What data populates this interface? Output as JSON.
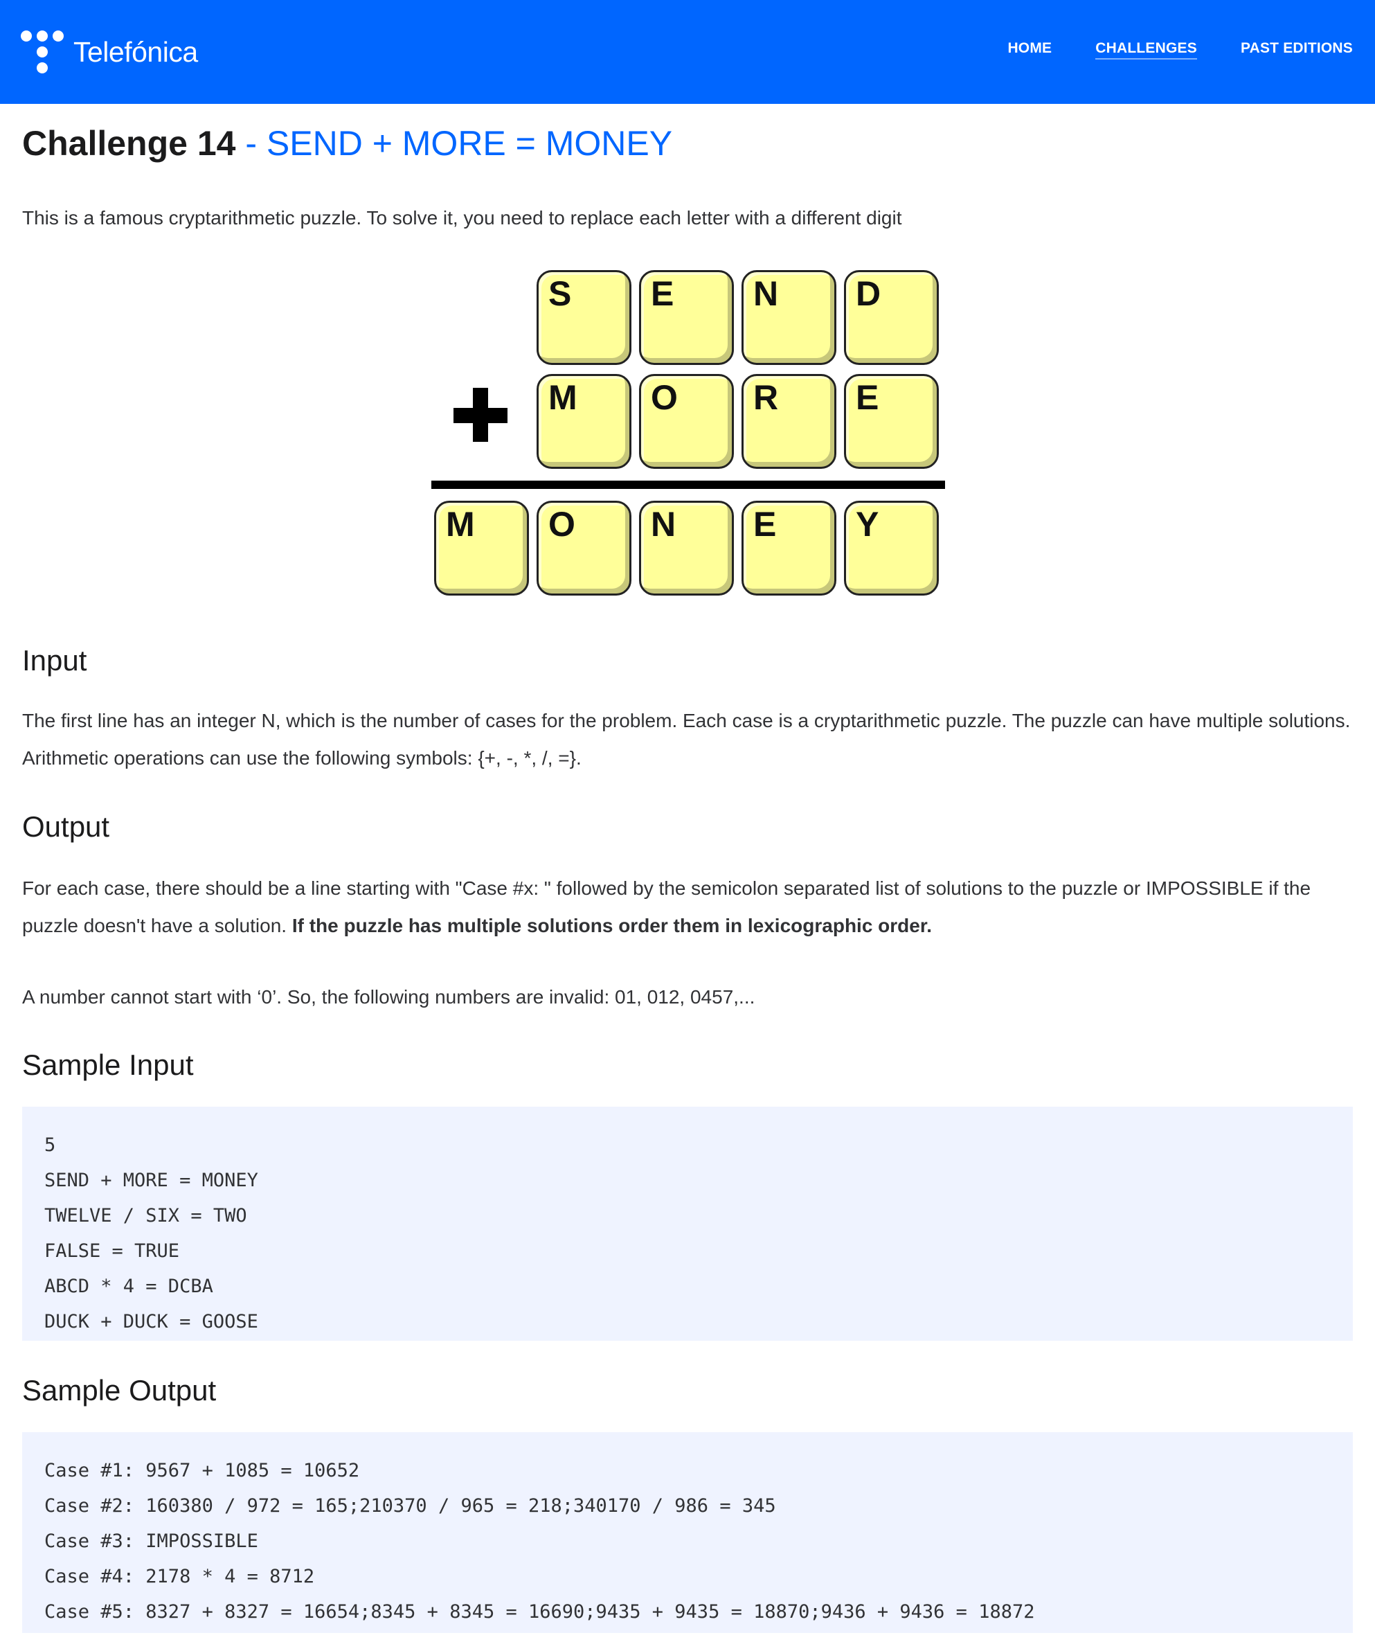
{
  "header": {
    "brand": "Telefónica",
    "nav": [
      {
        "label": "HOME"
      },
      {
        "label": "CHALLENGES"
      },
      {
        "label": "PAST EDITIONS"
      }
    ],
    "colors": {
      "bar": "#0066ff",
      "text": "#ffffff"
    }
  },
  "title": {
    "main": "Challenge 14",
    "sub": " - SEND + MORE = MONEY"
  },
  "intro": "This is a famous cryptarithmetic puzzle. To solve it, you need to replace each letter with a different digit",
  "puzzle": {
    "row1": [
      "S",
      "E",
      "N",
      "D"
    ],
    "operator": "+",
    "row2": [
      "M",
      "O",
      "R",
      "E"
    ],
    "row3": [
      "M",
      "O",
      "N",
      "E",
      "Y"
    ]
  },
  "input": {
    "heading": "Input",
    "text": "The first line has an integer N, which is the number of cases for the problem. Each case is a cryptarithmetic puzzle. The puzzle can have multiple solutions. Arithmetic operations can use the following symbols: {+, -, *, /, =}."
  },
  "output": {
    "heading": "Output",
    "text": "For each case, there should be a line starting with \"Case #x: \" followed by the semicolon separated list of solutions to the puzzle or IMPOSSIBLE if the puzzle doesn't have a solution. ",
    "bold": "If the puzzle has multiple solutions order them in lexicographic order.",
    "note": "A number cannot start with ‘0’. So, the following numbers are invalid: 01, 012, 0457,..."
  },
  "sample_input": {
    "heading": "Sample Input",
    "lines": [
      "5",
      "SEND + MORE = MONEY",
      "TWELVE / SIX = TWO",
      "FALSE = TRUE",
      "ABCD * 4 = DCBA",
      "DUCK + DUCK = GOOSE"
    ]
  },
  "sample_output": {
    "heading": "Sample Output",
    "lines": [
      "Case #1: 9567 + 1085 = 10652",
      "Case #2: 160380 / 972 = 165;210370 / 965 = 218;340170 / 986 = 345",
      "Case #3: IMPOSSIBLE",
      "Case #4: 2178 * 4 = 8712",
      "Case #5: 8327 + 8327 = 16654;8345 + 8345 = 16690;9435 + 9435 = 18870;9436 + 9436 = 18872"
    ]
  }
}
